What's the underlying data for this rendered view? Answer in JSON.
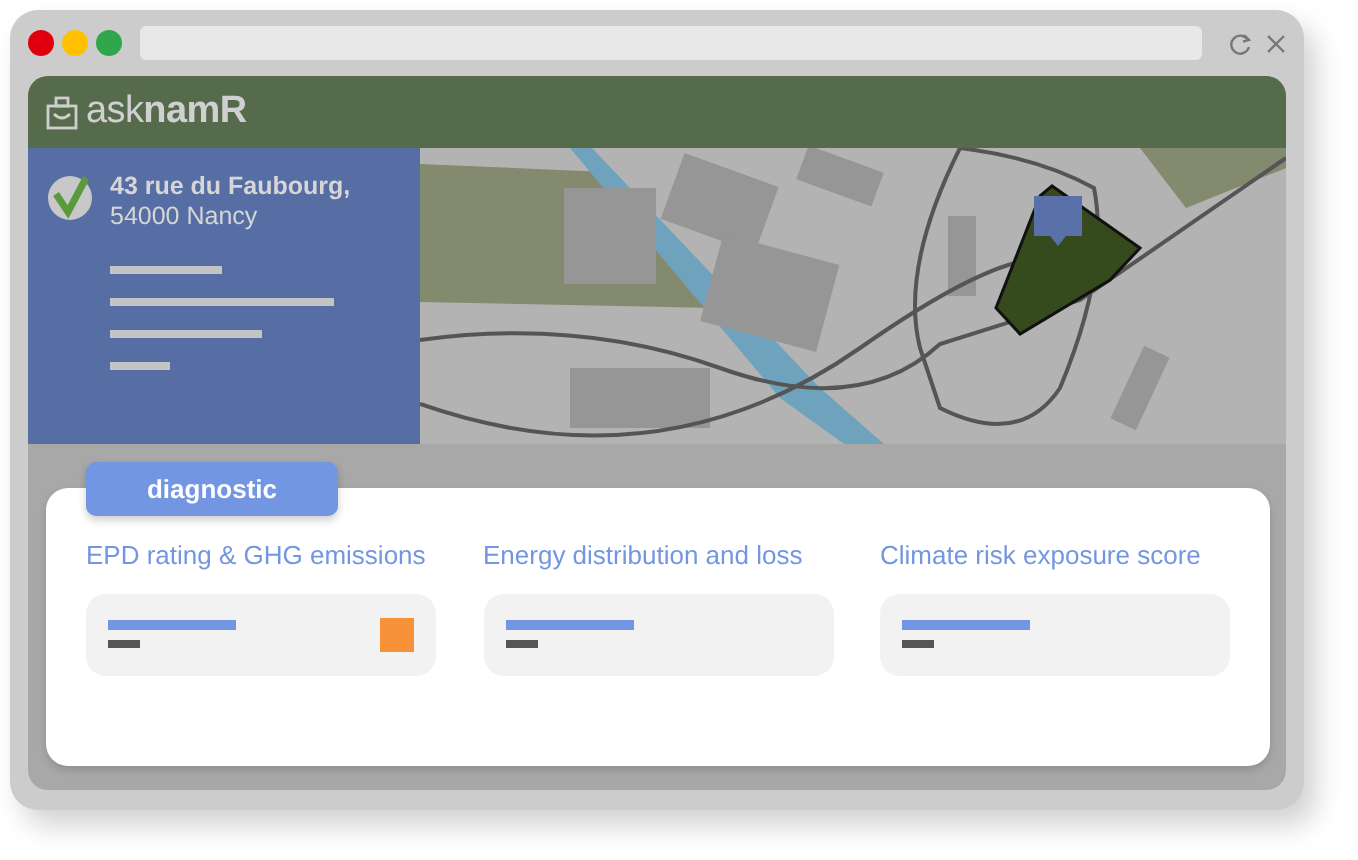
{
  "app": {
    "logo": "ask**namR**"
  },
  "address": {
    "line_1": "43 rue du Faubourg,",
    "line_2": "54000 Nancy"
  },
  "diagnostic": {
    "tab": "diagnostic",
    "cards": [
      {
        "title": "EPD rating & GHG emissions",
        "color": "#f79239"
      },
      {
        "title": "Energy distribution and loss"
      },
      {
        "title": "Climate risk exposure score"
      }
    ]
  }
}
